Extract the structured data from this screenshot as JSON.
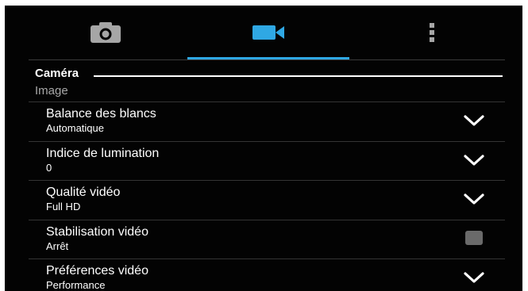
{
  "colors": {
    "background": "#030303",
    "accent": "#2fa8e4",
    "icon_inactive": "#a6a6a6",
    "text_primary": "#ffffff",
    "text_secondary": "#a8a8a8",
    "divider": "#343434",
    "checkbox_unchecked": "#6a6a6a"
  },
  "tabs": [
    {
      "icon": "camera-icon",
      "selected": false
    },
    {
      "icon": "video-camera-icon",
      "selected": true
    },
    {
      "icon": "more-options-icon",
      "selected": false
    }
  ],
  "category": {
    "label": "Caméra"
  },
  "section": {
    "label": "Image"
  },
  "settings": [
    {
      "title": "Balance des blancs",
      "value": "Automatique",
      "control": "dropdown",
      "icon": "chevron-down-icon"
    },
    {
      "title": "Indice de lumination",
      "value": "0",
      "control": "dropdown",
      "icon": "chevron-down-icon"
    },
    {
      "title": "Qualité vidéo",
      "value": "Full HD",
      "control": "dropdown",
      "icon": "chevron-down-icon"
    },
    {
      "title": "Stabilisation vidéo",
      "value": "Arrêt",
      "control": "checkbox",
      "checked": false
    },
    {
      "title": "Préférences vidéo",
      "value": "Performance",
      "control": "dropdown",
      "icon": "chevron-down-icon"
    }
  ]
}
